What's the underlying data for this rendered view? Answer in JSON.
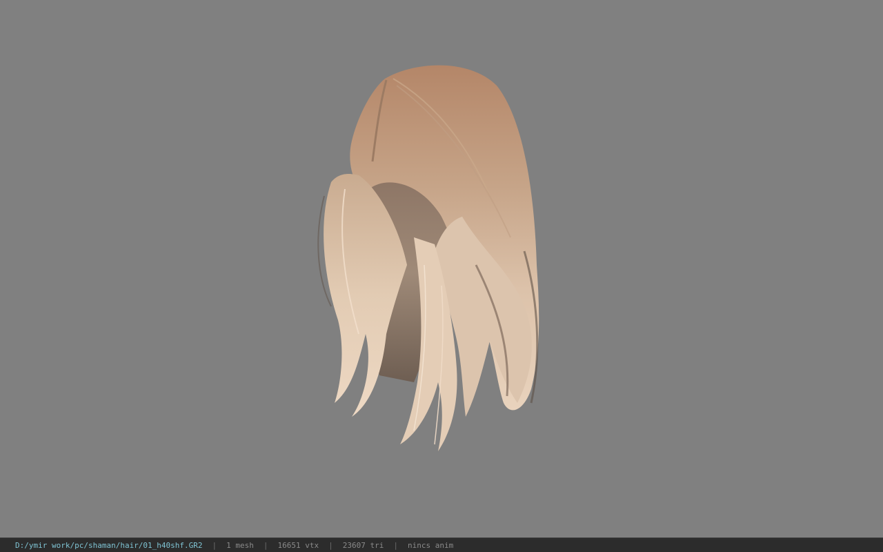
{
  "viewport": {
    "background": "#808080",
    "model_name": "hair mesh"
  },
  "colors": {
    "hair_root": "#b48668",
    "hair_mid": "#cdb39c",
    "hair_tip": "#e7cfb8",
    "hair_shadow": "#5e5046",
    "statusbar_bg": "#2c2c2c",
    "path_text": "#7fc3d3",
    "info_text": "#8a8a8a"
  },
  "status_bar": {
    "path": "D:/ymir work/pc/shaman/hair/01_h40shf.GR2",
    "separator": "|",
    "mesh_count": "1 mesh",
    "vertex_count": "16651 vtx",
    "triangle_count": "23607 tri",
    "anim": "nincs anim"
  }
}
